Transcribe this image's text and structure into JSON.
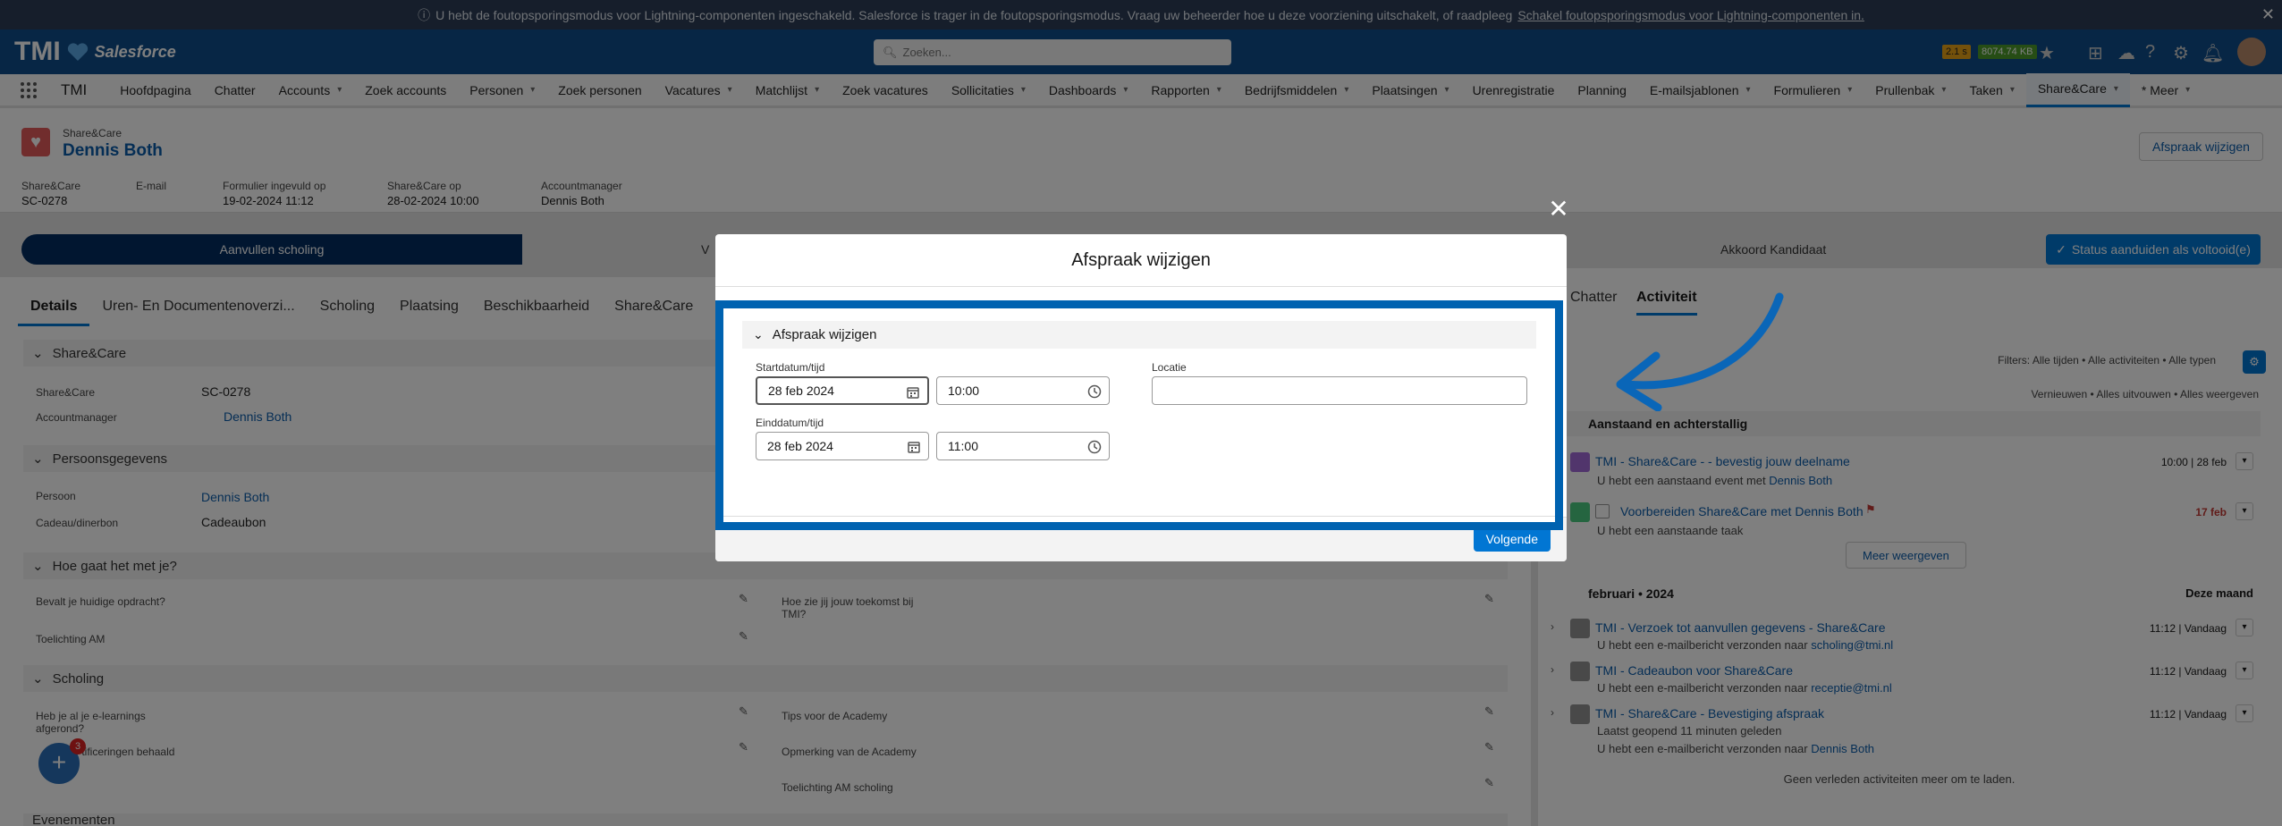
{
  "banner": {
    "text": "U hebt de foutopsporingsmodus voor Lightning-componenten ingeschakeld. Salesforce is trager in de foutopsporingsmodus. Vraag uw beheerder hoe u deze voorziening uitschakelt, of raadpleeg",
    "link": "Schakel foutopsporingsmodus voor Lightning-componenten in."
  },
  "header": {
    "brand": "TMI",
    "brand_sub": "Salesforce",
    "search_placeholder": "Zoeken...",
    "badge1": "2.1 s",
    "badge2": "8074.74 KB"
  },
  "nav": {
    "app_name": "TMI",
    "items": [
      {
        "label": "Hoofdpagina",
        "chev": false
      },
      {
        "label": "Chatter",
        "chev": false
      },
      {
        "label": "Accounts",
        "chev": true
      },
      {
        "label": "Zoek accounts",
        "chev": false
      },
      {
        "label": "Personen",
        "chev": true
      },
      {
        "label": "Zoek personen",
        "chev": false
      },
      {
        "label": "Vacatures",
        "chev": true
      },
      {
        "label": "Matchlijst",
        "chev": true
      },
      {
        "label": "Zoek vacatures",
        "chev": false
      },
      {
        "label": "Sollicitaties",
        "chev": true
      },
      {
        "label": "Dashboards",
        "chev": true
      },
      {
        "label": "Rapporten",
        "chev": true
      },
      {
        "label": "Bedrijfsmiddelen",
        "chev": true
      },
      {
        "label": "Plaatsingen",
        "chev": true
      },
      {
        "label": "Urenregistratie",
        "chev": false
      },
      {
        "label": "Planning",
        "chev": false
      },
      {
        "label": "E-mailsjablonen",
        "chev": true
      },
      {
        "label": "Formulieren",
        "chev": true
      },
      {
        "label": "Prullenbak",
        "chev": true
      },
      {
        "label": "Taken",
        "chev": true
      },
      {
        "label": "Share&Care",
        "chev": true
      },
      {
        "label": "* Meer",
        "chev": true
      }
    ]
  },
  "record": {
    "object": "Share&Care",
    "name": "Dennis Both",
    "edit_button": "Afspraak wijzigen",
    "fields": [
      {
        "label": "Share&Care",
        "value": "SC-0278"
      },
      {
        "label": "E-mail",
        "value": ""
      },
      {
        "label": "Formulier ingevuld op",
        "value": "19-02-2024 11:12"
      },
      {
        "label": "Share&Care op",
        "value": "28-02-2024 10:00"
      },
      {
        "label": "Accountmanager",
        "value": "Dennis Both"
      }
    ]
  },
  "path": {
    "steps": [
      "Aanvullen scholing",
      "V",
      "Akkoord Kandidaat"
    ],
    "complete_button": "Status aanduiden als voltooid(e)"
  },
  "tabs": [
    "Details",
    "Uren- En Documentenoverzi...",
    "Scholing",
    "Plaatsing",
    "Beschikbaarheid",
    "Share&Care"
  ],
  "right_tabs": [
    "Chatter",
    "Activiteit"
  ],
  "details": {
    "s1_title": "Share&Care",
    "s1_rows": [
      {
        "label": "Share&Care",
        "value": "SC-0278"
      },
      {
        "label": "Accountmanager",
        "value": "Dennis Both"
      }
    ],
    "s2_title": "Persoonsgegevens",
    "s2_rows": [
      {
        "label": "Persoon",
        "value": "Dennis Both"
      },
      {
        "label": "Cadeau/dinerbon",
        "value": "Cadeaubon"
      }
    ],
    "s3_title": "Hoe gaat het met je?",
    "s3_left": [
      "Bevalt je huidige opdracht?",
      "Toelichting AM"
    ],
    "s3_right": "Hoe zie jij jouw toekomst bij TMI?",
    "s4_title": "Scholing",
    "s4_left": [
      "Heb je al je e-learnings afgerond?",
      "Certificeringen behaald"
    ],
    "s4_right": [
      "Tips voor de Academy",
      "Opmerking van de Academy",
      "Toelichting AM scholing"
    ],
    "s5_title": "Evenementen",
    "badge_count": "3"
  },
  "activity": {
    "filters": "Filters: Alle tijden • Alle activiteiten • Alle typen",
    "links": "Vernieuwen • Alles uitvouwen • Alles weergeven",
    "upcoming_title": "Aanstaand en achterstallig",
    "upcoming": [
      {
        "title": "TMI - Share&Care - - bevestig jouw deelname",
        "sub": "U hebt een aanstaand event met",
        "sub_link": "Dennis Both",
        "date": "10:00 | 28 feb"
      },
      {
        "title": "Voorbereiden Share&Care met Dennis Both",
        "sub": "U hebt een aanstaande taak",
        "sub_link": "",
        "date": "17 feb"
      }
    ],
    "more_button": "Meer weergeven",
    "month_title": "februari • 2024",
    "month_right": "Deze maand",
    "emails": [
      {
        "title": "TMI - Verzoek tot aanvullen gegevens - Share&Care",
        "sub": "U hebt een e-mailbericht verzonden naar",
        "sub_link": "scholing@tmi.nl",
        "date": "11:12 | Vandaag",
        "extra": ""
      },
      {
        "title": "TMI - Cadeaubon voor Share&Care",
        "sub": "U hebt een e-mailbericht verzonden naar",
        "sub_link": "receptie@tmi.nl",
        "date": "11:12 | Vandaag",
        "extra": ""
      },
      {
        "title": "TMI - Share&Care - Bevestiging afspraak",
        "sub": "U hebt een e-mailbericht verzonden naar",
        "sub_link": "Dennis Both",
        "date": "11:12 | Vandaag",
        "extra": "Laatst geopend 11 minuten geleden"
      }
    ],
    "no_more": "Geen verleden activiteiten meer om te laden."
  },
  "modal": {
    "title": "Afspraak wijzigen",
    "section": "Afspraak wijzigen",
    "start_label": "Startdatum/tijd",
    "start_date": "28 feb 2024",
    "start_time": "10:00",
    "end_label": "Einddatum/tijd",
    "end_date": "28 feb 2024",
    "end_time": "11:00",
    "location_label": "Locatie",
    "location_value": "",
    "next_button": "Volgende"
  },
  "colors": {
    "header": "#0e4d8a",
    "accent": "#0176d3",
    "focus_border": "#0062b0",
    "arrow": "#0a66b8"
  }
}
